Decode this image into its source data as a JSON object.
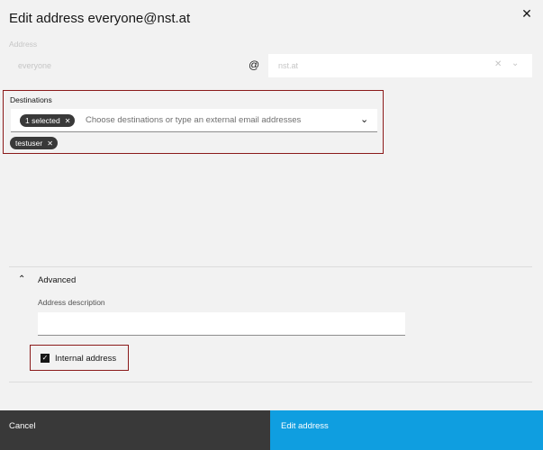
{
  "modal": {
    "title": "Edit address everyone@nst.at",
    "close_icon": "close-icon"
  },
  "address": {
    "label": "Address",
    "local_part": "everyone",
    "at_symbol": "@",
    "domain_value": "nst.at",
    "clear_icon": "close-icon",
    "dropdown_icon": "chevron-down-icon"
  },
  "destinations": {
    "label": "Destinations",
    "selected_tag": "1 selected",
    "placeholder": "Choose destinations or type an external email addresses",
    "dropdown_icon": "chevron-down-icon",
    "chips": [
      {
        "label": "testuser"
      }
    ]
  },
  "advanced": {
    "label": "Advanced",
    "expanded": true,
    "description_label": "Address description",
    "description_value": "",
    "internal_label": "Internal address",
    "internal_checked": true
  },
  "footer": {
    "cancel_label": "Cancel",
    "submit_label": "Edit address"
  },
  "colors": {
    "primary": "#0f9ee0",
    "secondary": "#393939",
    "highlight_border": "#8b1a1a"
  }
}
